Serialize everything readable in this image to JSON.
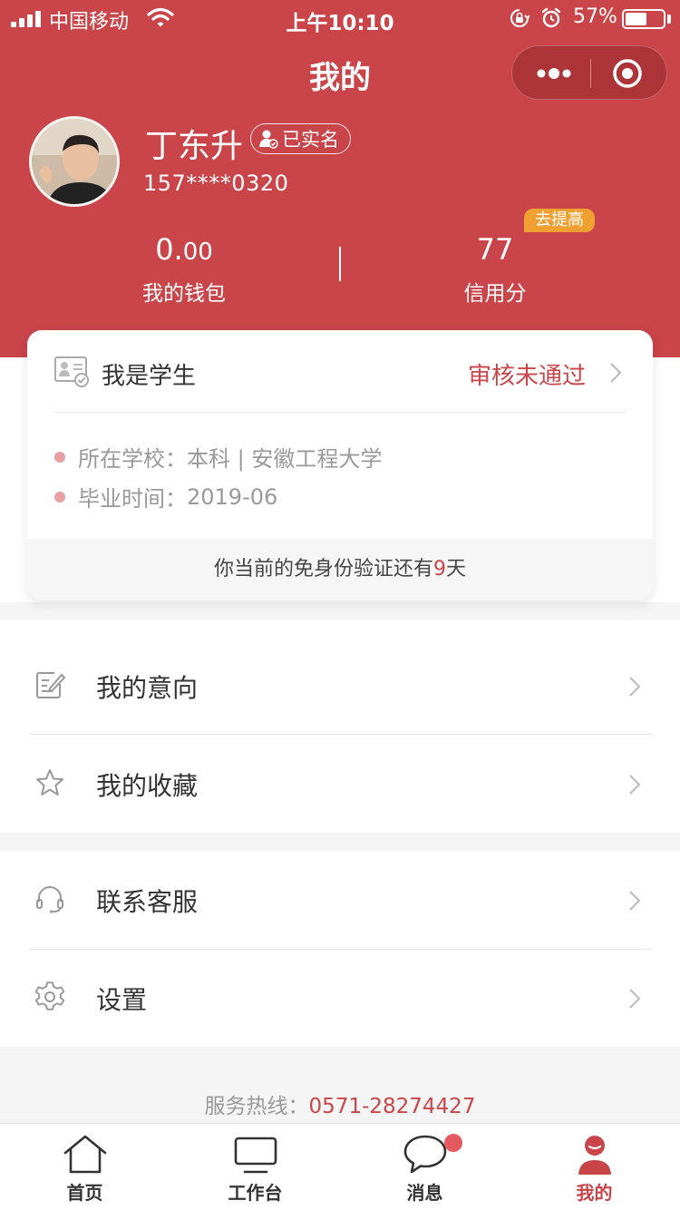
{
  "status_bar": {
    "carrier": "中国移动",
    "time": "上午10:10",
    "battery": "57%",
    "battery_level": 0.57
  },
  "nav": {
    "title": "我的"
  },
  "profile": {
    "name": "丁东升",
    "verified_label": "已实名",
    "phone": "157****0320"
  },
  "stats": {
    "wallet_int": "0.",
    "wallet_dec": "00",
    "wallet_label": "我的钱包",
    "credit_value": "77",
    "credit_label": "信用分",
    "improve_label": "去提高"
  },
  "student_card": {
    "title": "我是学生",
    "status": "审核未通过",
    "school_label": "所在学校：",
    "school_value": "本科 | 安徽工程大学",
    "grad_label": "毕业时间：",
    "grad_value": "2019-06",
    "footer_prefix": "你当前的免身份验证还有",
    "footer_days": "9",
    "footer_suffix": "天"
  },
  "menu": {
    "intent": "我的意向",
    "favorites": "我的收藏",
    "support": "联系客服",
    "settings": "设置"
  },
  "hotline": {
    "label": "服务热线：",
    "number": "0571-28274427"
  },
  "tabbar": {
    "home": "首页",
    "workbench": "工作台",
    "messages": "消息",
    "mine": "我的"
  },
  "colors": {
    "brand": "#c9454a",
    "badge_orange": "#f0a030"
  }
}
